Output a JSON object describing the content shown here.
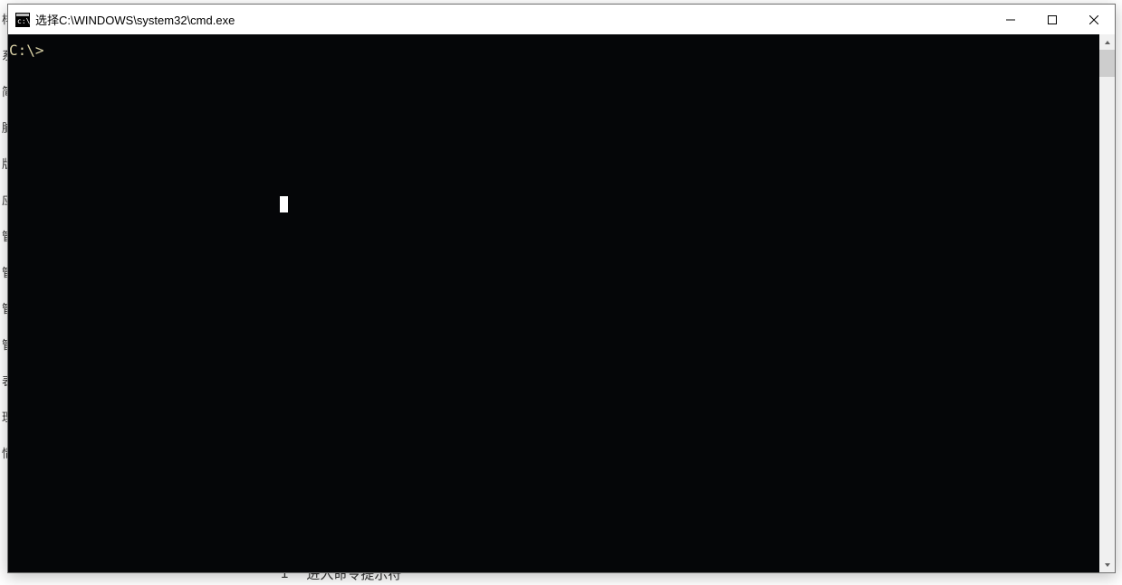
{
  "background": {
    "sidebar_items": [
      "样",
      "系统",
      "简",
      "脑",
      "版本",
      "应",
      "管理",
      "管理",
      "管理",
      "管理",
      "表",
      "理",
      "情况"
    ],
    "bottom_number": "1",
    "bottom_text": "进入命令提示符"
  },
  "window": {
    "title": "选择C:\\WINDOWS\\system32\\cmd.exe"
  },
  "console": {
    "prompt": "C:\\>",
    "selection_cursor": {
      "visible": true
    }
  }
}
